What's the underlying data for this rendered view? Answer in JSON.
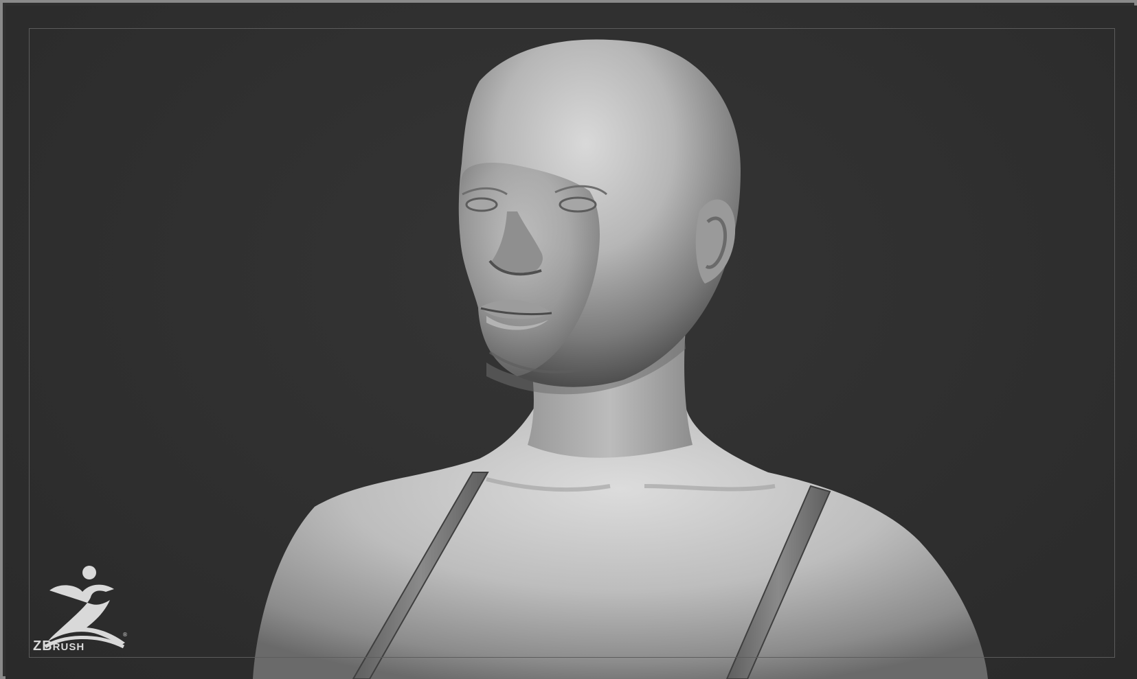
{
  "app": {
    "name": "ZBrush",
    "logo_text_big": "ZB",
    "logo_text_small": "RUSH",
    "registered_mark": "®"
  },
  "viewport": {
    "subject": "bust-sculpt",
    "material": "matcap-gray"
  },
  "icons": {
    "logo": "zbrush-logo-icon"
  },
  "colors": {
    "background": "#303030",
    "frame": "#8a8a8a",
    "sculpt_light": "#d8d8d8",
    "sculpt_mid": "#a0a0a0",
    "sculpt_dark": "#4a4a4a",
    "logo": "#d9d9d9"
  }
}
